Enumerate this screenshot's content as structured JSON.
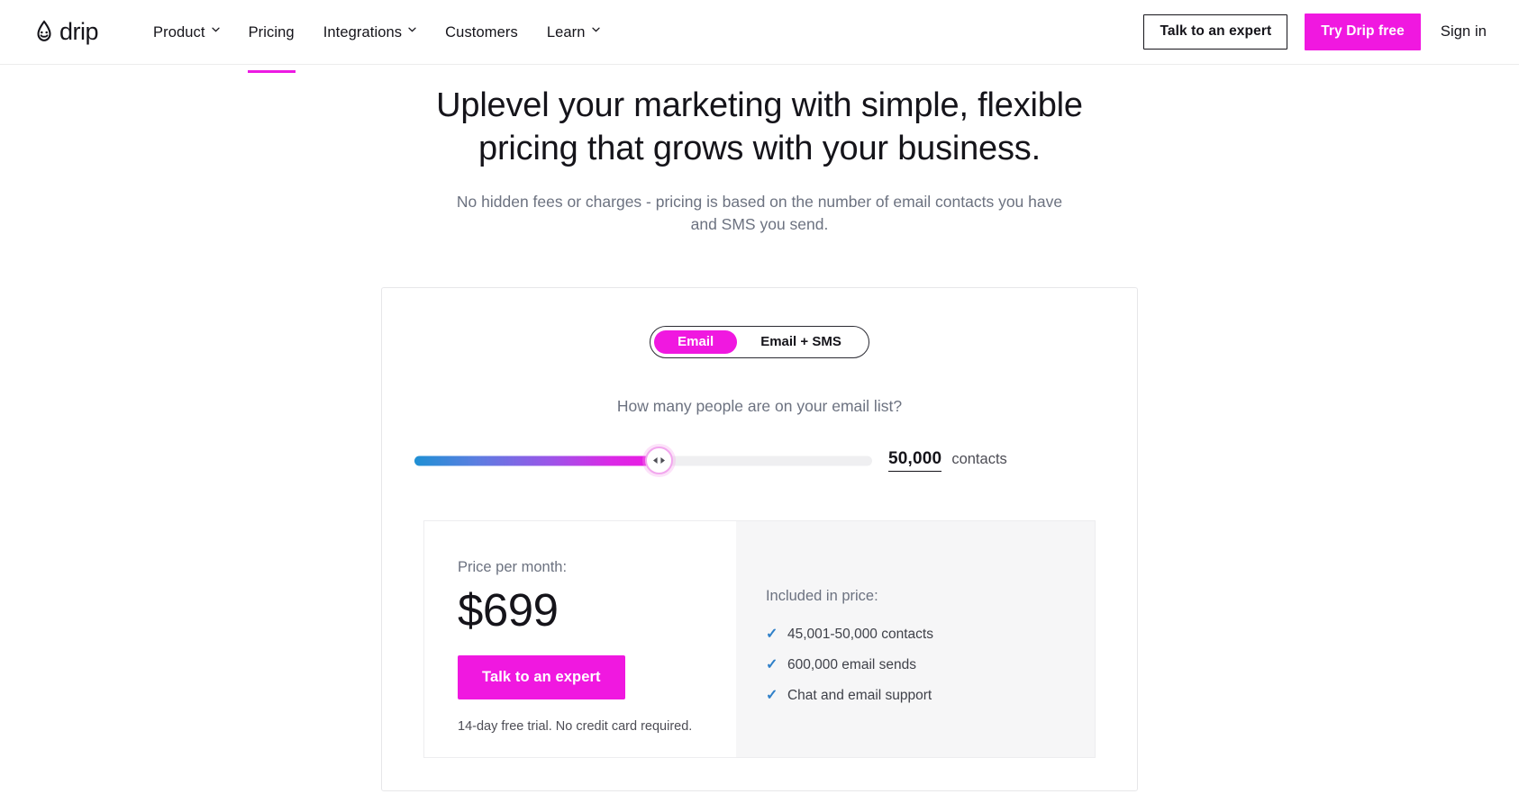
{
  "brand": {
    "name": "drip",
    "accent": "#f018e0",
    "logo_icon": "drip-droplet-face-logo"
  },
  "nav": {
    "links": [
      {
        "label": "Product",
        "has_caret": true,
        "active": false
      },
      {
        "label": "Pricing",
        "has_caret": false,
        "active": true
      },
      {
        "label": "Integrations",
        "has_caret": true,
        "active": false
      },
      {
        "label": "Customers",
        "has_caret": false,
        "active": false
      },
      {
        "label": "Learn",
        "has_caret": true,
        "active": false
      }
    ],
    "talk_to_expert": "Talk to an expert",
    "try_free": "Try Drip free",
    "sign_in": "Sign in"
  },
  "hero": {
    "heading": "Uplevel your marketing with simple, flexible pricing that grows with your business.",
    "subheading": "No hidden fees or charges - pricing is based on the number of email contacts you have and SMS you send."
  },
  "calculator": {
    "toggle": {
      "options": [
        "Email",
        "Email + SMS"
      ],
      "selected": "Email"
    },
    "question": "How many people are on your email list?",
    "slider": {
      "value": "50,000",
      "unit": "contacts",
      "fill_percent": 53.4,
      "gradient_start": "#1f90d4",
      "gradient_end": "#ee18e2",
      "track_color": "#efeff1"
    },
    "price": {
      "label": "Price per month:",
      "amount": "$699",
      "cta": "Talk to an expert",
      "fine_print": "14-day free trial. No credit card required."
    },
    "included": {
      "label": "Included in price:",
      "items": [
        "45,001-50,000 contacts",
        "600,000 email sends",
        "Chat and email support"
      ],
      "check_color": "#2f80c9"
    }
  }
}
